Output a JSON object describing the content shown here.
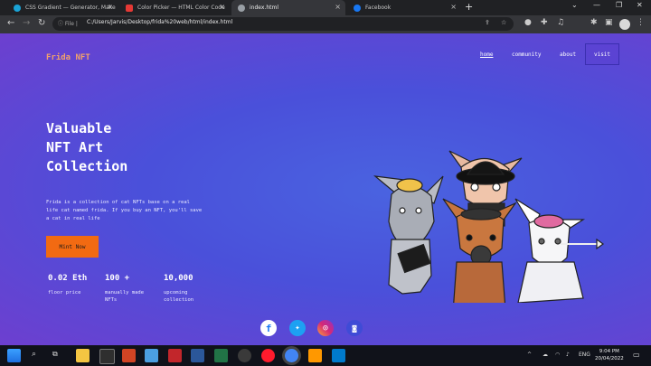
{
  "browser": {
    "tabs": [
      {
        "title": "CSS Gradient — Generator, Make",
        "color": "#1aa3d6"
      },
      {
        "title": "Color Picker — HTML Color Code",
        "color": "#e53935"
      },
      {
        "title": "index.html",
        "color": "#9aa0a6"
      },
      {
        "title": "Facebook",
        "color": "#1877f2"
      }
    ],
    "new_tab": "+",
    "info_label": "File",
    "url": "C:/Users/Jarvis/Desktop/frida%20web/html/index.html"
  },
  "site": {
    "brand": "Frida NFT",
    "nav": {
      "home": "home",
      "community": "community",
      "about": "about",
      "visit": "visit"
    },
    "hero_title": "Valuable\nNFT Art\nCollection",
    "description": "Frida is a collection of cat NFTs base on a real life cat named frida. If you buy an NFT, you'll save a cat in real life",
    "mint_label": "Mint Now",
    "stats": [
      {
        "value": "0.02 Eth",
        "label": "floor price"
      },
      {
        "value": "100 +",
        "label": "manually made\nNFTs"
      },
      {
        "value": "10,000",
        "label": "upcoming\ncollection"
      }
    ],
    "social": [
      "facebook-icon",
      "twitter-icon",
      "instagram-icon",
      "discord-icon"
    ]
  },
  "taskbar": {
    "language": "ENG",
    "time": "9:04 PM",
    "date": "20/04/2022"
  },
  "colors": {
    "accent": "#f26a12",
    "brand": "#f2a26b",
    "bg_blue": "#4a52dc"
  }
}
